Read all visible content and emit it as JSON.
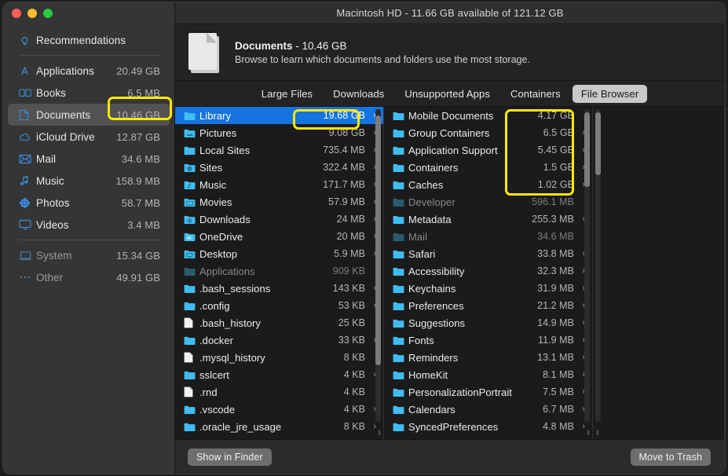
{
  "window": {
    "title": "Macintosh HD - 11.66 GB available of 121.12 GB",
    "traffic_lights": [
      "close",
      "minimize",
      "zoom"
    ]
  },
  "sidebar": {
    "items": [
      {
        "label": "Recommendations",
        "size": "",
        "icon": "lightbulb-icon",
        "dim": false,
        "selected": false
      },
      {
        "label": "Applications",
        "size": "20.49 GB",
        "icon": "appstore-icon",
        "dim": false,
        "selected": false
      },
      {
        "label": "Books",
        "size": "6.5 MB",
        "icon": "book-icon",
        "dim": false,
        "selected": false
      },
      {
        "label": "Documents",
        "size": "10.46 GB",
        "icon": "document-icon",
        "dim": false,
        "selected": true
      },
      {
        "label": "iCloud Drive",
        "size": "12.87 GB",
        "icon": "cloud-icon",
        "dim": false,
        "selected": false
      },
      {
        "label": "Mail",
        "size": "34.6 MB",
        "icon": "envelope-icon",
        "dim": false,
        "selected": false
      },
      {
        "label": "Music",
        "size": "158.9 MB",
        "icon": "music-note-icon",
        "dim": false,
        "selected": false
      },
      {
        "label": "Photos",
        "size": "58.7 MB",
        "icon": "photos-flower-icon",
        "dim": false,
        "selected": false
      },
      {
        "label": "Videos",
        "size": "3.4 MB",
        "icon": "display-icon",
        "dim": false,
        "selected": false
      },
      {
        "label": "System",
        "size": "15.34 GB",
        "icon": "laptop-icon",
        "dim": true,
        "selected": false
      },
      {
        "label": "Other",
        "size": "49.91 GB",
        "icon": "ellipsis-icon",
        "dim": true,
        "selected": false
      }
    ]
  },
  "detail": {
    "title_bold": "Documents",
    "title_size": " - 10.46 GB",
    "subtitle": "Browse to learn which documents and folders use the most storage."
  },
  "tabs": [
    {
      "label": "Large Files",
      "active": false
    },
    {
      "label": "Downloads",
      "active": false
    },
    {
      "label": "Unsupported Apps",
      "active": false
    },
    {
      "label": "Containers",
      "active": false
    },
    {
      "label": "File Browser",
      "active": true
    }
  ],
  "columns": [
    {
      "name": "column-1",
      "scroll_thumb": {
        "top_pct": 2,
        "height_pct": 80
      },
      "rows": [
        {
          "name": "Library",
          "size": "19.68 GB",
          "icon": "folder-icon",
          "chevron": true,
          "selected": true,
          "dim": false
        },
        {
          "name": "Pictures",
          "size": "9.08 GB",
          "icon": "folder-pictures-icon",
          "chevron": true,
          "selected": false,
          "dim": false
        },
        {
          "name": "Local Sites",
          "size": "735.4 MB",
          "icon": "folder-icon",
          "chevron": true,
          "selected": false,
          "dim": false
        },
        {
          "name": "Sites",
          "size": "322.4 MB",
          "icon": "folder-sites-icon",
          "chevron": true,
          "selected": false,
          "dim": false
        },
        {
          "name": "Music",
          "size": "171.7 MB",
          "icon": "folder-music-icon",
          "chevron": true,
          "selected": false,
          "dim": false
        },
        {
          "name": "Movies",
          "size": "57.9 MB",
          "icon": "folder-movies-icon",
          "chevron": true,
          "selected": false,
          "dim": false
        },
        {
          "name": "Downloads",
          "size": "24 MB",
          "icon": "folder-downloads-icon",
          "chevron": true,
          "selected": false,
          "dim": false
        },
        {
          "name": "OneDrive",
          "size": "20 MB",
          "icon": "folder-cloud-icon",
          "chevron": true,
          "selected": false,
          "dim": false
        },
        {
          "name": "Desktop",
          "size": "5.9 MB",
          "icon": "folder-desktop-icon",
          "chevron": true,
          "selected": false,
          "dim": false
        },
        {
          "name": "Applications",
          "size": "909 KB",
          "icon": "folder-applications-icon",
          "chevron": false,
          "selected": false,
          "dim": true
        },
        {
          "name": ".bash_sessions",
          "size": "143 KB",
          "icon": "folder-icon",
          "chevron": true,
          "selected": false,
          "dim": false
        },
        {
          "name": ".config",
          "size": "53 KB",
          "icon": "folder-icon",
          "chevron": true,
          "selected": false,
          "dim": false
        },
        {
          "name": ".bash_history",
          "size": "25 KB",
          "icon": "file-icon",
          "chevron": false,
          "selected": false,
          "dim": false
        },
        {
          "name": ".docker",
          "size": "33 KB",
          "icon": "folder-icon",
          "chevron": true,
          "selected": false,
          "dim": false
        },
        {
          "name": ".mysql_history",
          "size": "8 KB",
          "icon": "file-icon",
          "chevron": false,
          "selected": false,
          "dim": false
        },
        {
          "name": "sslcert",
          "size": "4 KB",
          "icon": "folder-icon",
          "chevron": true,
          "selected": false,
          "dim": false
        },
        {
          "name": ".rnd",
          "size": "4 KB",
          "icon": "file-icon",
          "chevron": false,
          "selected": false,
          "dim": false
        },
        {
          "name": ".vscode",
          "size": "4 KB",
          "icon": "folder-icon",
          "chevron": true,
          "selected": false,
          "dim": false
        },
        {
          "name": ".oracle_jre_usage",
          "size": "8 KB",
          "icon": "folder-icon",
          "chevron": true,
          "selected": false,
          "dim": false
        }
      ]
    },
    {
      "name": "column-2",
      "scroll_thumb": {
        "top_pct": 1,
        "height_pct": 24
      },
      "rows": [
        {
          "name": "Mobile Documents",
          "size": "4.17 GB",
          "icon": "folder-icon",
          "chevron": false,
          "selected": false,
          "dim": false
        },
        {
          "name": "Group Containers",
          "size": "6.5 GB",
          "icon": "folder-icon",
          "chevron": true,
          "selected": false,
          "dim": false
        },
        {
          "name": "Application Support",
          "size": "5.45 GB",
          "icon": "folder-icon",
          "chevron": true,
          "selected": false,
          "dim": false
        },
        {
          "name": "Containers",
          "size": "1.5 GB",
          "icon": "folder-icon",
          "chevron": true,
          "selected": false,
          "dim": false
        },
        {
          "name": "Caches",
          "size": "1.02 GB",
          "icon": "folder-icon",
          "chevron": true,
          "selected": false,
          "dim": false
        },
        {
          "name": "Developer",
          "size": "596.1 MB",
          "icon": "folder-icon",
          "chevron": false,
          "selected": false,
          "dim": true
        },
        {
          "name": "Metadata",
          "size": "255.3 MB",
          "icon": "folder-icon",
          "chevron": true,
          "selected": false,
          "dim": false
        },
        {
          "name": "Mail",
          "size": "34.6 MB",
          "icon": "folder-icon",
          "chevron": false,
          "selected": false,
          "dim": true
        },
        {
          "name": "Safari",
          "size": "33.8 MB",
          "icon": "folder-icon",
          "chevron": true,
          "selected": false,
          "dim": false
        },
        {
          "name": "Accessibility",
          "size": "32.3 MB",
          "icon": "folder-icon",
          "chevron": true,
          "selected": false,
          "dim": false
        },
        {
          "name": "Keychains",
          "size": "31.9 MB",
          "icon": "folder-icon",
          "chevron": true,
          "selected": false,
          "dim": false
        },
        {
          "name": "Preferences",
          "size": "21.2 MB",
          "icon": "folder-icon",
          "chevron": true,
          "selected": false,
          "dim": false
        },
        {
          "name": "Suggestions",
          "size": "14.9 MB",
          "icon": "folder-icon",
          "chevron": true,
          "selected": false,
          "dim": false
        },
        {
          "name": "Fonts",
          "size": "11.9 MB",
          "icon": "folder-icon",
          "chevron": true,
          "selected": false,
          "dim": false
        },
        {
          "name": "Reminders",
          "size": "13.1 MB",
          "icon": "folder-icon",
          "chevron": true,
          "selected": false,
          "dim": false
        },
        {
          "name": "HomeKit",
          "size": "8.1 MB",
          "icon": "folder-icon",
          "chevron": true,
          "selected": false,
          "dim": false
        },
        {
          "name": "PersonalizationPortrait",
          "size": "7.5 MB",
          "icon": "folder-icon",
          "chevron": true,
          "selected": false,
          "dim": false
        },
        {
          "name": "Calendars",
          "size": "6.7 MB",
          "icon": "folder-icon",
          "chevron": true,
          "selected": false,
          "dim": false
        },
        {
          "name": "SyncedPreferences",
          "size": "4.8 MB",
          "icon": "folder-icon",
          "chevron": true,
          "selected": false,
          "dim": false
        }
      ]
    },
    {
      "name": "column-3",
      "scroll_thumb": {
        "top_pct": 1,
        "height_pct": 20
      },
      "rows": []
    }
  ],
  "bottom_bar": {
    "show_in_finder": "Show in Finder",
    "move_to_trash": "Move to Trash"
  },
  "annotations": {
    "color": "#ffe800",
    "boxes": [
      {
        "name": "documents-size-highlight",
        "target": "sidebar Documents size"
      },
      {
        "name": "library-size-highlight",
        "target": "column-1 Library size"
      },
      {
        "name": "library-subfolders-highlight",
        "target": "column-2 top five sizes"
      }
    ]
  }
}
